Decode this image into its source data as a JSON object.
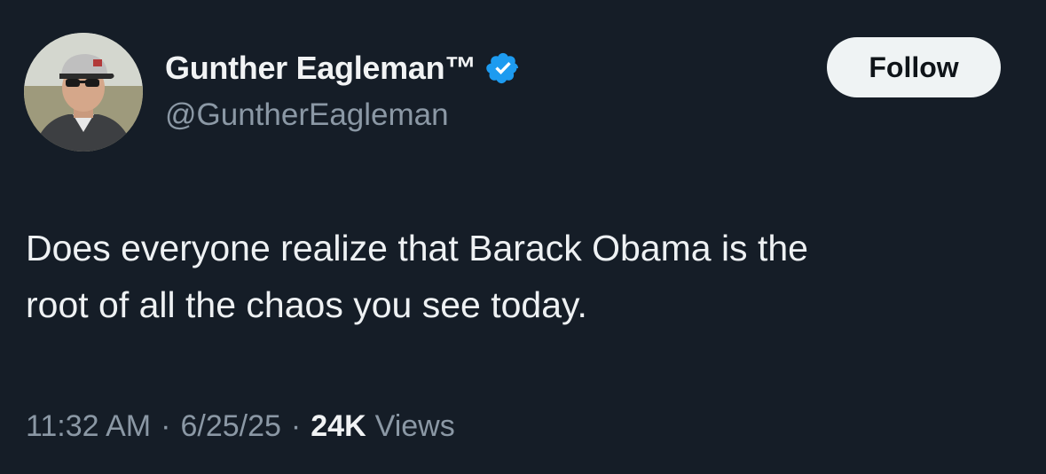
{
  "author": {
    "display_name": "Gunther Eagleman™",
    "handle": "@GuntherEagleman",
    "verified_icon": "verified-badge-icon",
    "avatar_icon": "profile-photo"
  },
  "actions": {
    "follow_label": "Follow"
  },
  "tweet": {
    "line1": "Does everyone realize that Barack Obama is the",
    "line2": "root of all the chaos you see today."
  },
  "meta": {
    "time": "11:32 AM",
    "separator": "·",
    "date": "6/25/25",
    "views_count": "24K",
    "views_label": "Views"
  },
  "colors": {
    "background": "#151d27",
    "text_primary": "#e7e9ea",
    "text_secondary": "#8b98a5",
    "verified_blue": "#1d9bf0",
    "follow_bg": "#eff3f4"
  }
}
